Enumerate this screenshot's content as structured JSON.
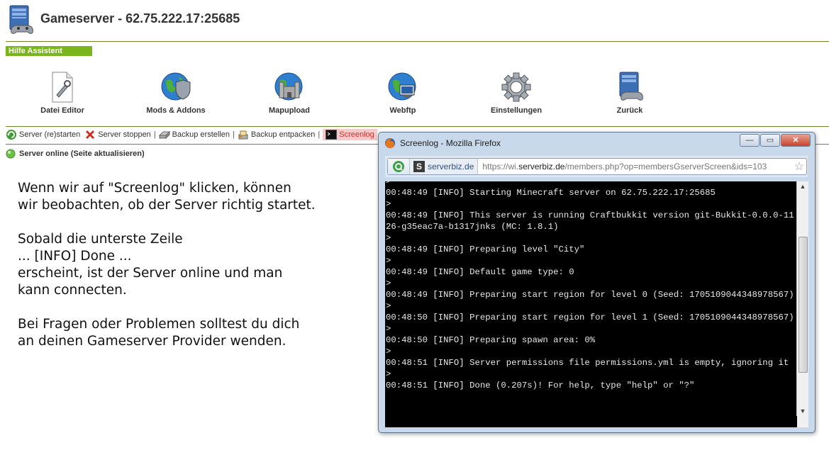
{
  "header": {
    "title": "Gameserver - 62.75.222.17:25685",
    "help_label": "Hilfe Assistent"
  },
  "tools": [
    {
      "label": "Datei Editor",
      "icon": "file-editor-icon"
    },
    {
      "label": "Mods & Addons",
      "icon": "globe-shield-icon"
    },
    {
      "label": "Mapupload",
      "icon": "globe-castle-icon"
    },
    {
      "label": "Webftp",
      "icon": "globe-monitor-icon"
    },
    {
      "label": "Einstellungen",
      "icon": "gear-icon"
    },
    {
      "label": "Zurück",
      "icon": "gameserver-computer-icon"
    }
  ],
  "actions": {
    "restart": "Server (re)starten",
    "stop": "Server stoppen",
    "backup_create": "Backup erstellen",
    "backup_unpack": "Backup entpacken",
    "screenlog": "Screenlog",
    "separator": "|"
  },
  "status": {
    "text": "Server online (Seite aktualisieren)",
    "color": "#4caf50"
  },
  "explanation": {
    "p1": "Wenn wir auf \"Screenlog\" klicken, können\nwir beobachten, ob der Server richtig startet.",
    "p2": "Sobald die unterste Zeile\n... [INFO] Done ...\nerscheint, ist der Server online und man\nkann connecten.",
    "p3": "Bei Fragen oder Problemen solltest du dich\nan deinen Gameserver Provider wenden."
  },
  "firefox": {
    "title": "Screenlog - Mozilla Firefox",
    "site_letter": "S",
    "site_name": "serverbiz.de",
    "url_prefix": "https://wi.",
    "url_domain": "serverbiz.de",
    "url_path": "/members.php?op=membersGserverScreen&ids=103",
    "win_minimize": "—",
    "win_maximize": "▭",
    "win_close": "✕"
  },
  "log_lines": [
    ">",
    "00:48:49 [INFO] Starting Minecraft server on 62.75.222.17:25685",
    ">",
    "00:48:49 [INFO] This server is running Craftbukkit version git-Bukkit-0.0.0-1126-g35eac7a-b1317jnks (MC: 1.8.1)",
    ">",
    "00:48:49 [INFO] Preparing level \"City\"",
    ">",
    "00:48:49 [INFO] Default game type: 0",
    ">",
    "00:48:49 [INFO] Preparing start region for level 0 (Seed: 1705109044348978567)",
    ">",
    "00:48:50 [INFO] Preparing start region for level 1 (Seed: 1705109044348978567)",
    ">",
    "00:48:50 [INFO] Preparing spawn area: 0%",
    ">",
    "00:48:51 [INFO] Server permissions file permissions.yml is empty, ignoring it",
    ">",
    "00:48:51 [INFO] Done (0.207s)! For help, type \"help\" or \"?\""
  ]
}
